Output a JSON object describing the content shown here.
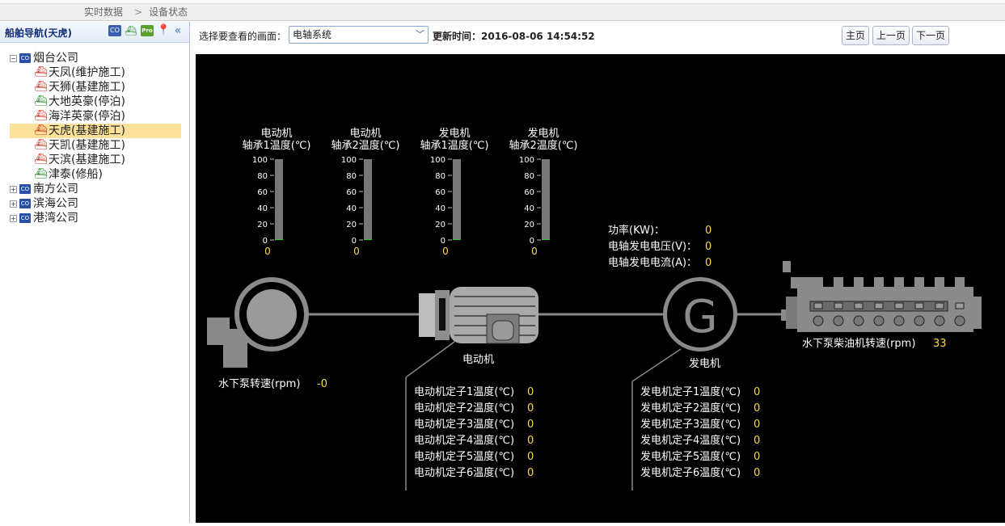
{
  "breadcrumb": {
    "root": "实时数据",
    "separator": ">",
    "current": "设备状态"
  },
  "sidebar": {
    "title": "船舶导航(天虎)",
    "tools": [
      "CO",
      "ship",
      "Pro",
      "pin",
      "«"
    ],
    "tree": [
      {
        "label": "烟台公司",
        "expanded": true,
        "children": [
          {
            "label": "天凤(维护施工)",
            "status": "red"
          },
          {
            "label": "天狮(基建施工)",
            "status": "red"
          },
          {
            "label": "大地英豪(停泊)",
            "status": "green"
          },
          {
            "label": "海洋英豪(停泊)",
            "status": "red"
          },
          {
            "label": "天虎(基建施工)",
            "status": "red",
            "selected": true
          },
          {
            "label": "天凯(基建施工)",
            "status": "red"
          },
          {
            "label": "天滨(基建施工)",
            "status": "red"
          },
          {
            "label": "津泰(修船)",
            "status": "green"
          }
        ]
      },
      {
        "label": "南方公司",
        "expanded": false
      },
      {
        "label": "滨海公司",
        "expanded": false
      },
      {
        "label": "港湾公司",
        "expanded": false
      }
    ]
  },
  "toolbar": {
    "select_label": "选择要查看的画面：",
    "selected_view": "电轴系统",
    "update_label": "更新时间：",
    "update_time": "2016-08-06 14:54:52",
    "home_button": "主页",
    "prev_button": "上一页",
    "next_button": "下一页"
  },
  "scada": {
    "gauges": [
      {
        "line1": "电动机",
        "line2": "轴承1温度(℃)",
        "value": 0
      },
      {
        "line1": "电动机",
        "line2": "轴承2温度(℃)",
        "value": 0
      },
      {
        "line1": "发电机",
        "line2": "轴承1温度(℃)",
        "value": 0
      },
      {
        "line1": "发电机",
        "line2": "轴承2温度(℃)",
        "value": 0
      }
    ],
    "gauge_ticks": [
      "100",
      "80",
      "60",
      "40",
      "20",
      "0"
    ],
    "power": [
      {
        "label": "功率(KW)：",
        "value": "0"
      },
      {
        "label": "电轴发电电压(V)：",
        "value": "0"
      },
      {
        "label": "电轴发电电流(A)：",
        "value": "0"
      }
    ],
    "pump_label": "水下泵转速(rpm)",
    "pump_value": "-0",
    "motor_label": "电动机",
    "generator_label": "发电机",
    "generator_letter": "G",
    "diesel_label": "水下泵柴油机转速(rpm)",
    "diesel_value": "33",
    "motor_temps": [
      {
        "label": "电动机定子1温度(℃)",
        "value": "0"
      },
      {
        "label": "电动机定子2温度(℃)",
        "value": "0"
      },
      {
        "label": "电动机定子3温度(℃)",
        "value": "0"
      },
      {
        "label": "电动机定子4温度(℃)",
        "value": "0"
      },
      {
        "label": "电动机定子5温度(℃)",
        "value": "0"
      },
      {
        "label": "电动机定子6温度(℃)",
        "value": "0"
      }
    ],
    "generator_temps": [
      {
        "label": "发电机定子1温度(℃)",
        "value": "0"
      },
      {
        "label": "发电机定子2温度(℃)",
        "value": "0"
      },
      {
        "label": "发电机定子3温度(℃)",
        "value": "0"
      },
      {
        "label": "发电机定子4温度(℃)",
        "value": "0"
      },
      {
        "label": "发电机定子5温度(℃)",
        "value": "0"
      },
      {
        "label": "发电机定子6温度(℃)",
        "value": "0"
      }
    ],
    "value_color": "#ffd84a",
    "label_color": "#ffffff"
  }
}
